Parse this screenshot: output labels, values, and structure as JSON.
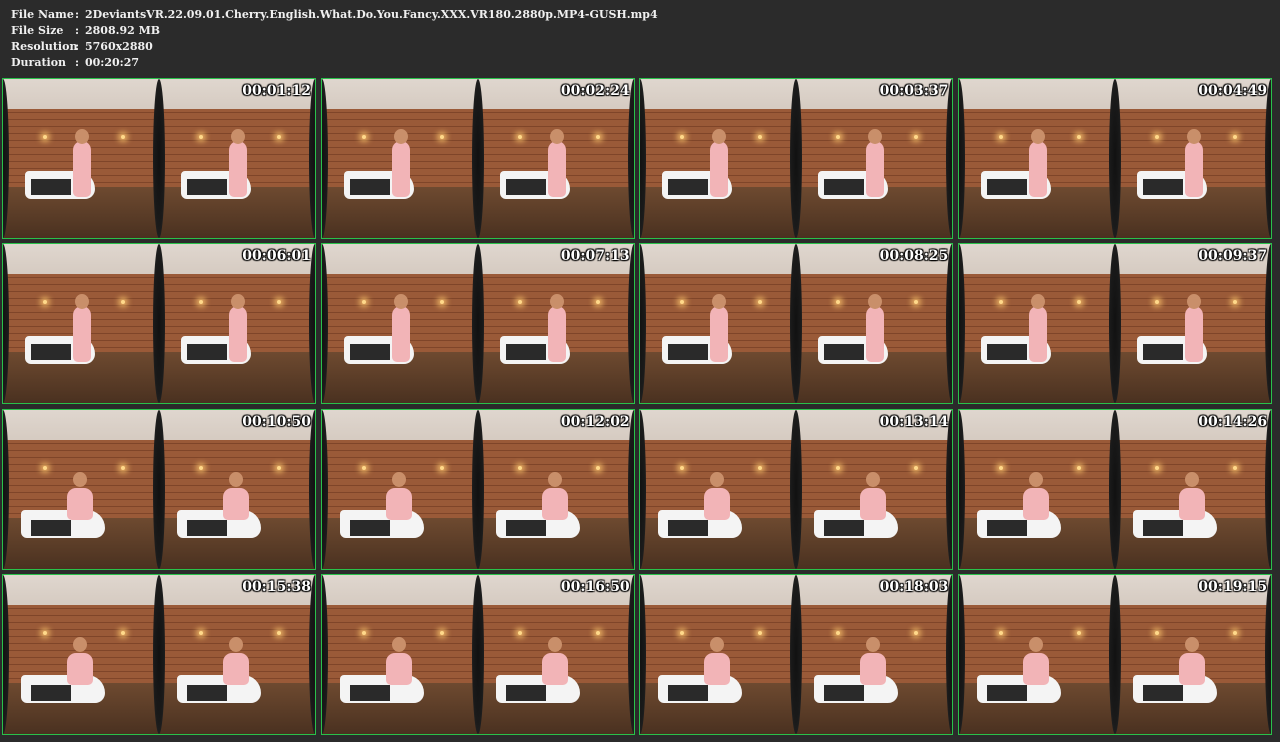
{
  "header": {
    "file_name_label": "File Name",
    "file_name": "2DeviantsVR.22.09.01.Cherry.English.What.Do.You.Fancy.XXX.VR180.2880p.MP4-GUSH.mp4",
    "file_size_label": "File Size",
    "file_size": "2808.92 MB",
    "resolution_label": "Resolution",
    "resolution": "5760x2880",
    "duration_label": "Duration",
    "duration": "00:20:27",
    "separator": ":"
  },
  "thumbnails": [
    "00:01:12",
    "00:02:24",
    "00:03:37",
    "00:04:49",
    "00:06:01",
    "00:07:13",
    "00:08:25",
    "00:09:37",
    "00:10:50",
    "00:12:02",
    "00:13:14",
    "00:14:26",
    "00:15:38",
    "00:16:50",
    "00:18:03",
    "00:19:15"
  ],
  "colors": {
    "background": "#2b2b2b",
    "text": "#f0f0f0",
    "thumb_border": "#29c14a"
  }
}
